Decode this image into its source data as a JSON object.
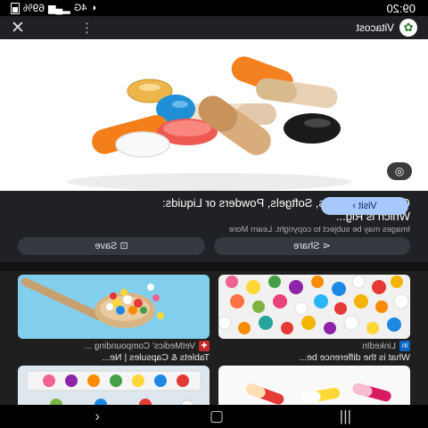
{
  "status": {
    "time": "09:20",
    "battery": "69%",
    "network": "4G"
  },
  "header": {
    "source_name": "Vitacost",
    "logo_glyph": "✿"
  },
  "result": {
    "title": "Capsules, Tablets, Softgels, Powders or Liquids: Which is Rig...",
    "copyright_note": "Images may be subject to copyright. Learn More",
    "visit_label": "Visit",
    "share_label": "Share",
    "save_label": "Save"
  },
  "related": [
    {
      "source": "LinkedIn",
      "title": "What is the difference be..."
    },
    {
      "source": "VetMedics' Compounding ...",
      "title": "Tablets & Capsules | Ne..."
    }
  ],
  "colors": {
    "accent": "#a8c7fa",
    "surface": "#202124",
    "chip": "#34383f"
  }
}
